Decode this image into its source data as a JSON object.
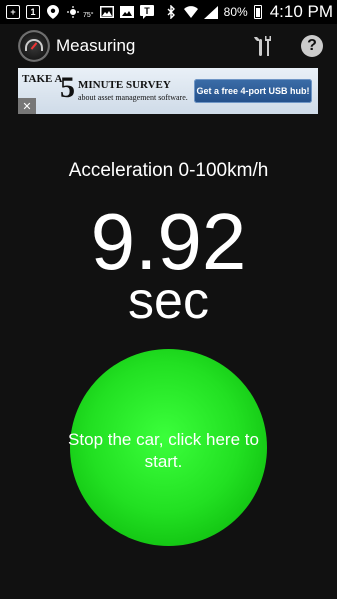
{
  "status_bar": {
    "temperature": "75°",
    "battery_percent": "80%",
    "time": "4:10 PM",
    "icons": [
      "add-icon",
      "calendar-icon",
      "location-icon",
      "weather-icon",
      "image-icon",
      "gallery-icon",
      "text-icon",
      "bluetooth-icon",
      "wifi-icon",
      "signal-icon",
      "battery-icon"
    ]
  },
  "app_bar": {
    "title": "Measuring",
    "actions": [
      "tools-icon",
      "help-icon"
    ]
  },
  "ad": {
    "take_a": "TAKE A",
    "number": "5",
    "minute_survey": "MINUTE SURVEY",
    "about": "about asset management software.",
    "cta": "Get a free 4-port USB hub!",
    "close": "✕"
  },
  "main": {
    "measure_label": "Acceleration 0-100km/h",
    "result_value": "9.92",
    "result_unit": "sec",
    "start_text": "Stop the car, click here to start."
  },
  "colors": {
    "background": "#111111",
    "button_green": "#22e022",
    "text": "#ffffff"
  }
}
